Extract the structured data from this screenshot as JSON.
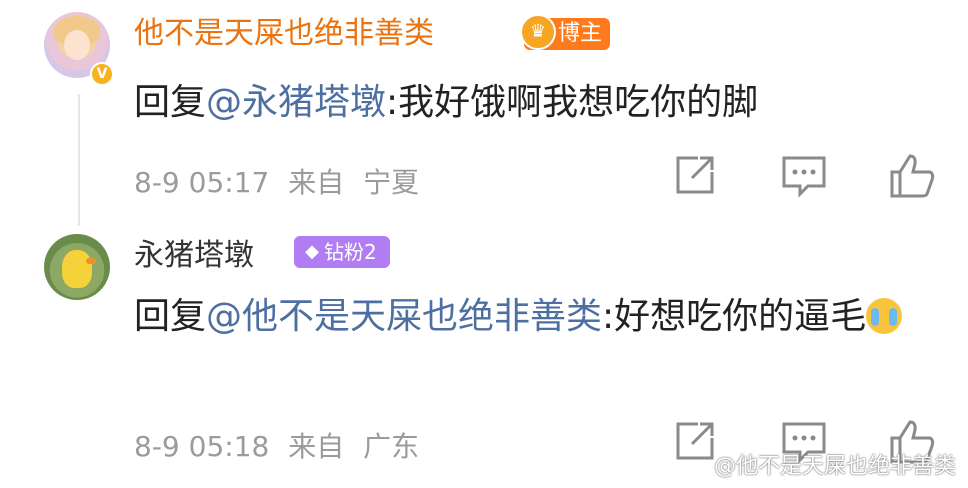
{
  "comments": [
    {
      "username": "他不是天屎也绝非善类",
      "badge": "博主",
      "reply_prefix": "回复",
      "mention": "@永猪塔墩",
      "text": ":我好饿啊我想吃你的脚",
      "date": "8-9 05:17",
      "from_label": "来自",
      "location": "宁夏",
      "verified": "V"
    },
    {
      "username": "永猪塔墩",
      "badge": "钻粉2",
      "reply_prefix": "回复",
      "mention": "@他不是天屎也绝非善类",
      "text": ":好想吃你的逼毛",
      "date": "8-9 05:18",
      "from_label": "来自",
      "location": "广东"
    }
  ],
  "watermark": "@他不是天屎也绝非善类",
  "icons": {
    "share": "share-icon",
    "comment": "comment-icon",
    "like": "like-icon",
    "emoji": "crying-emoji-icon"
  },
  "colors": {
    "author_name": "#eb7310",
    "mention": "#4d6fa1",
    "meta": "#9b9b9b",
    "blogger_badge": "#ff7a1c",
    "fan_badge": "#b07ef2"
  }
}
